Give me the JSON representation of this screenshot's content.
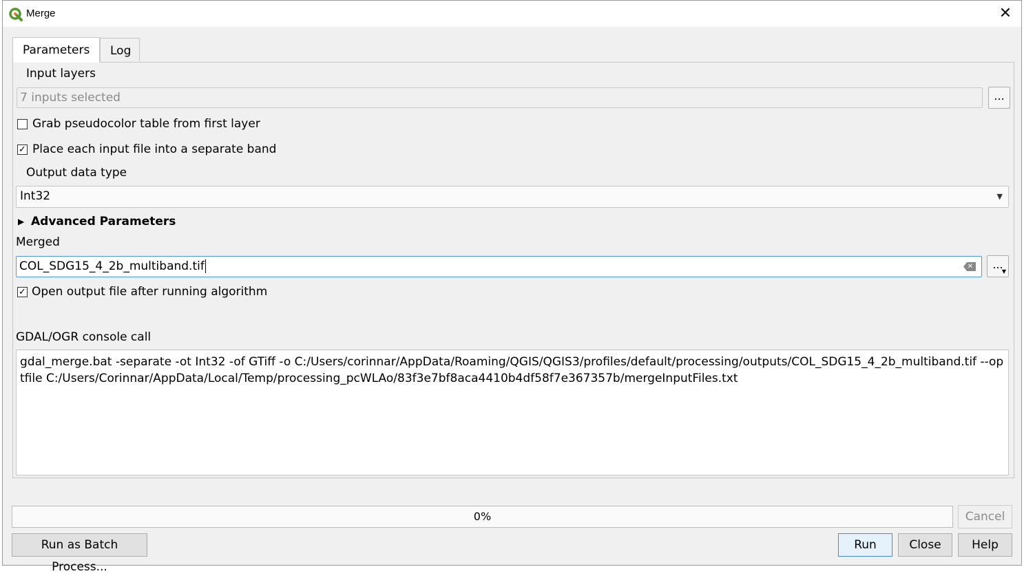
{
  "window": {
    "title": "Merge"
  },
  "tabs": [
    {
      "label": "Parameters",
      "active": true
    },
    {
      "label": "Log",
      "active": false
    }
  ],
  "input_layers": {
    "label": "Input layers",
    "value": "7 inputs selected",
    "browse_label": "..."
  },
  "options": {
    "grab_pseudocolor": {
      "label": "Grab pseudocolor table from first layer",
      "checked": false
    },
    "separate_band": {
      "label": "Place each input file into a separate band",
      "checked": true
    }
  },
  "output_type": {
    "label": "Output data type",
    "value": "Int32"
  },
  "advanced": {
    "label": "Advanced Parameters"
  },
  "merged": {
    "label": "Merged",
    "value": "COL_SDG15_4_2b_multiband.tif",
    "browse_label": "..."
  },
  "open_output": {
    "label": "Open output file after running algorithm",
    "checked": true
  },
  "console": {
    "label": "GDAL/OGR console call",
    "command": "gdal_merge.bat -separate -ot Int32 -of GTiff -o C:/Users/corinnar/AppData/Roaming/QGIS/QGIS3/profiles/default/processing/outputs/COL_SDG15_4_2b_multiband.tif --optfile C:/Users/Corinnar/AppData/Local/Temp/processing_pcWLAo/83f3e7bf8aca4410b4df58f7e367357b/mergeInputFiles.txt"
  },
  "progress": {
    "text": "0%",
    "value": 0
  },
  "buttons": {
    "cancel": "Cancel",
    "batch": "Run as Batch Process...",
    "run": "Run",
    "close": "Close",
    "help": "Help"
  },
  "colors": {
    "accent": "#3c8dda",
    "qgis_green": "#589632"
  }
}
